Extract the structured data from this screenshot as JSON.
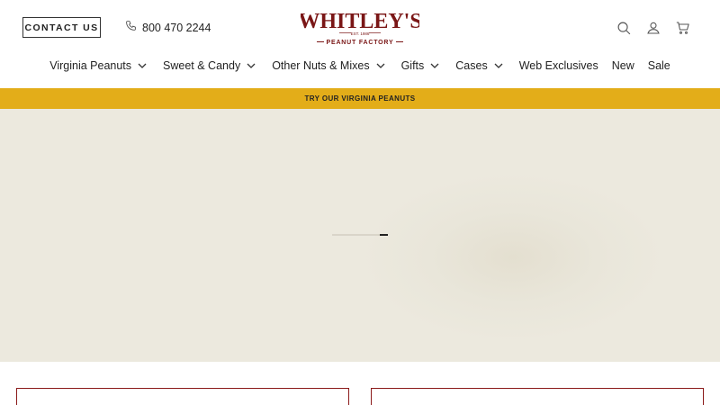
{
  "header": {
    "contact_label": "CONTACT US",
    "phone": "800 470 2244",
    "logo": {
      "brand": "WHITLEY'S",
      "est": "EST. 1986",
      "tagline": "PEANUT FACTORY",
      "color": "#7a1616"
    },
    "icons": [
      "search-icon",
      "account-icon",
      "cart-icon"
    ]
  },
  "nav": {
    "items": [
      {
        "label": "Virginia Peanuts",
        "has_dropdown": true
      },
      {
        "label": "Sweet & Candy",
        "has_dropdown": true
      },
      {
        "label": "Other Nuts & Mixes",
        "has_dropdown": true
      },
      {
        "label": "Gifts",
        "has_dropdown": true
      },
      {
        "label": "Cases",
        "has_dropdown": true
      },
      {
        "label": "Web Exclusives",
        "has_dropdown": false
      },
      {
        "label": "New",
        "has_dropdown": false
      },
      {
        "label": "Sale",
        "has_dropdown": false
      }
    ]
  },
  "promo": {
    "text": "TRY OUR VIRGINIA PEANUTS",
    "color": "#e3ad19"
  },
  "hero": {
    "background": "#ece9de",
    "loading_progress": 0.15
  },
  "colors": {
    "card_border": "#8b1a1a"
  }
}
